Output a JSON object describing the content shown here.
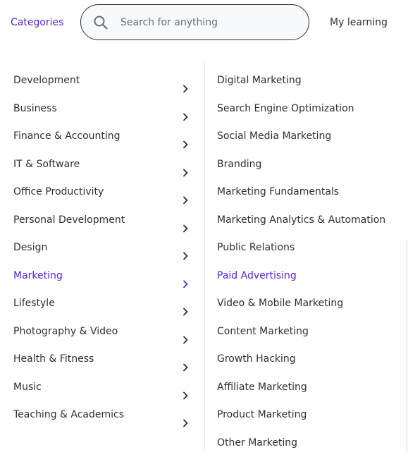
{
  "header": {
    "categories_label": "Categories",
    "search_placeholder": "Search for anything",
    "my_learning_label": "My learning"
  },
  "colors": {
    "accent": "#5624d0",
    "text": "#2d2f31"
  },
  "categories": [
    {
      "label": "Development",
      "icon": "chevron-right-icon"
    },
    {
      "label": "Business",
      "icon": "chevron-right-icon"
    },
    {
      "label": "Finance & Accounting",
      "icon": "chevron-right-icon"
    },
    {
      "label": "IT & Software",
      "icon": "chevron-right-icon"
    },
    {
      "label": "Office Productivity",
      "icon": "chevron-right-icon"
    },
    {
      "label": "Personal Development",
      "icon": "chevron-right-icon"
    },
    {
      "label": "Design",
      "icon": "chevron-right-icon"
    },
    {
      "label": "Marketing",
      "icon": "chevron-right-icon",
      "active": true
    },
    {
      "label": "Lifestyle",
      "icon": "chevron-right-icon"
    },
    {
      "label": "Photography & Video",
      "icon": "chevron-right-icon"
    },
    {
      "label": "Health & Fitness",
      "icon": "chevron-right-icon"
    },
    {
      "label": "Music",
      "icon": "chevron-right-icon"
    },
    {
      "label": "Teaching & Academics",
      "icon": "chevron-right-icon"
    }
  ],
  "subcategories": [
    {
      "label": "Digital Marketing"
    },
    {
      "label": "Search Engine Optimization"
    },
    {
      "label": "Social Media Marketing"
    },
    {
      "label": "Branding"
    },
    {
      "label": "Marketing Fundamentals"
    },
    {
      "label": "Marketing Analytics & Automation"
    },
    {
      "label": "Public Relations"
    },
    {
      "label": "Paid Advertising",
      "active": true
    },
    {
      "label": "Video & Mobile Marketing"
    },
    {
      "label": "Content Marketing"
    },
    {
      "label": "Growth Hacking"
    },
    {
      "label": "Affiliate Marketing"
    },
    {
      "label": "Product Marketing"
    },
    {
      "label": "Other Marketing"
    }
  ]
}
